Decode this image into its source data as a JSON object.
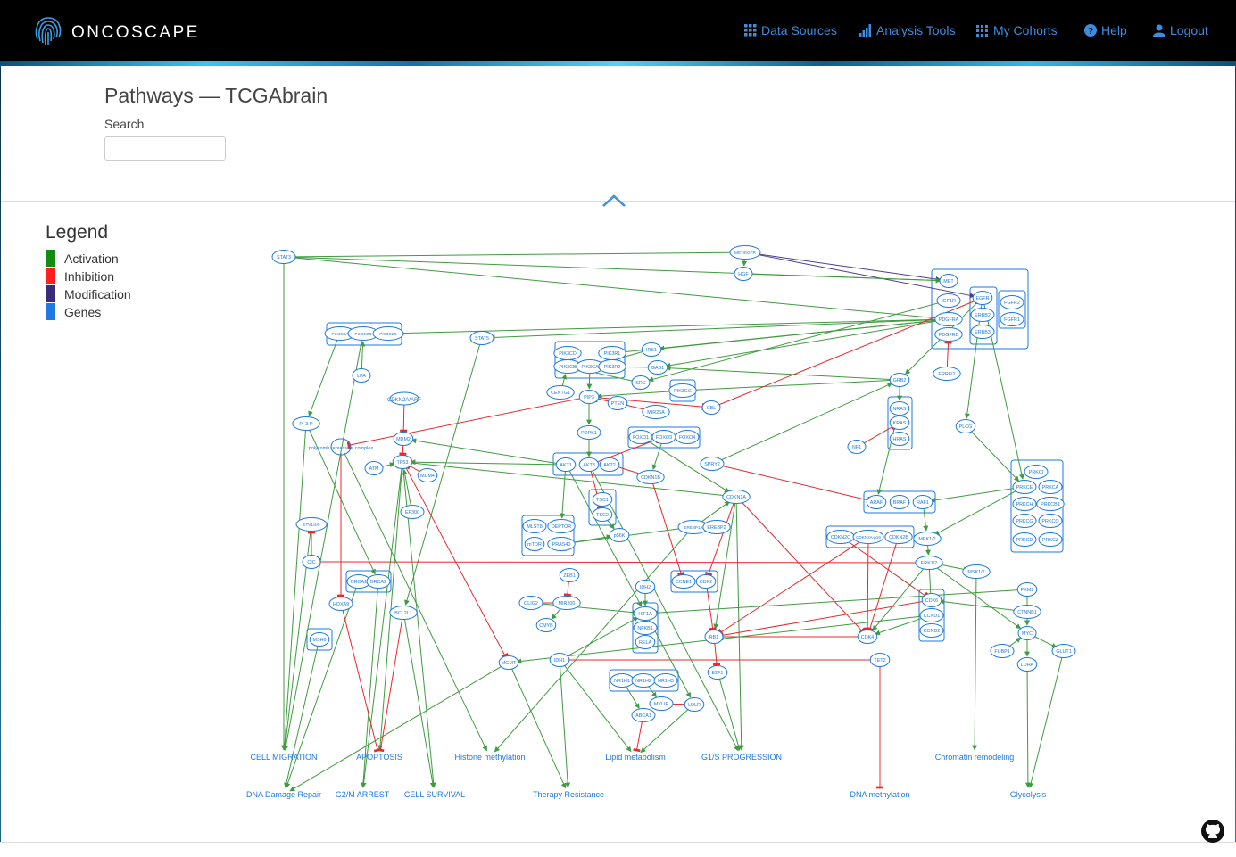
{
  "header": {
    "brand": "ONCOSCAPE",
    "nav": [
      {
        "label": "Data Sources",
        "icon": "grid-icon"
      },
      {
        "label": "Analysis Tools",
        "icon": "bar-chart-icon"
      },
      {
        "label": "My Cohorts",
        "icon": "dots-grid-icon"
      },
      {
        "label": "Help",
        "icon": "question-icon"
      },
      {
        "label": "Logout",
        "icon": "user-icon"
      }
    ]
  },
  "page": {
    "title": "Pathways — TCGAbrain",
    "search_label": "Search",
    "search_value": ""
  },
  "legend": {
    "title": "Legend",
    "items": [
      {
        "label": "Activation",
        "color": "#138c13"
      },
      {
        "label": "Inhibition",
        "color": "#ff1f1f"
      },
      {
        "label": "Modification",
        "color": "#3a2c7a"
      },
      {
        "label": "Genes",
        "color": "#1e7ae0"
      }
    ]
  },
  "colors": {
    "gene": "#1e7ae0",
    "activation": "#3f9b3f",
    "inhibition": "#e8282d",
    "modification": "#4d3c8c"
  },
  "groups": [
    {
      "id": "rtk"
    },
    {
      "id": "egfr"
    },
    {
      "id": "fgfr"
    },
    {
      "id": "pi3kc2"
    },
    {
      "id": "pi3k"
    },
    {
      "id": "pik3c2g"
    },
    {
      "id": "foxo"
    },
    {
      "id": "akt"
    },
    {
      "id": "tsc"
    },
    {
      "id": "mtor"
    },
    {
      "id": "ras"
    },
    {
      "id": "raf"
    },
    {
      "id": "prkc"
    },
    {
      "id": "cdkn2"
    },
    {
      "id": "brca"
    },
    {
      "id": "ccne"
    },
    {
      "id": "hif"
    },
    {
      "id": "cdk6"
    },
    {
      "id": "nr1h"
    },
    {
      "id": "msh6"
    }
  ],
  "nodes": [
    {
      "id": "STAT3",
      "label": "STAT3"
    },
    {
      "id": "METEGFR",
      "label": "MET/EGFR"
    },
    {
      "id": "HGF",
      "label": "HGF"
    },
    {
      "id": "MET",
      "label": "MET"
    },
    {
      "id": "IGF1R",
      "label": "IGF1R"
    },
    {
      "id": "EGFR",
      "label": "EGFR"
    },
    {
      "id": "ERBB2",
      "label": "ERBB2"
    },
    {
      "id": "ERBB3",
      "label": "ERBB3"
    },
    {
      "id": "FGFR2",
      "label": "FGFR2"
    },
    {
      "id": "FGFR1",
      "label": "FGFR1"
    },
    {
      "id": "PDGFRA",
      "label": "PDGFRA"
    },
    {
      "id": "PDGFRB",
      "label": "PDGFRB"
    },
    {
      "id": "ERRFI1",
      "label": "ERRFI1"
    },
    {
      "id": "PIK3C2A",
      "label": "PIK3C2A"
    },
    {
      "id": "PIK3C2B",
      "label": "PIK3C2B"
    },
    {
      "id": "PIK3C2G",
      "label": "PIK3C2G"
    },
    {
      "id": "STAT5",
      "label": "STAT5"
    },
    {
      "id": "LPA",
      "label": "LPA"
    },
    {
      "id": "PIK3CD",
      "label": "PIK3CD"
    },
    {
      "id": "PIK3CB",
      "label": "PIK3CB"
    },
    {
      "id": "PIK3CA",
      "label": "PIK3CA"
    },
    {
      "id": "PIK3R1",
      "label": "PIK3R1"
    },
    {
      "id": "PIK3R2",
      "label": "PIK3R2"
    },
    {
      "id": "IRS1",
      "label": "IRS1"
    },
    {
      "id": "GAB1",
      "label": "GAB1"
    },
    {
      "id": "SRC",
      "label": "SRC"
    },
    {
      "id": "CENTG1",
      "label": "CENTG1"
    },
    {
      "id": "PIP3",
      "label": "PIP3"
    },
    {
      "id": "PTEN",
      "label": "PTEN"
    },
    {
      "id": "MIR26A",
      "label": "MIR26A"
    },
    {
      "id": "PIK3CG",
      "label": "PIK3CG"
    },
    {
      "id": "CBL",
      "label": "CBL"
    },
    {
      "id": "GRB2",
      "label": "GRB2"
    },
    {
      "id": "CDKN2AARF",
      "label": "CDKN2A/ARF"
    },
    {
      "id": "PI3P",
      "label": "PI-3-P"
    },
    {
      "id": "POLY",
      "label": "polycomb repressive complex"
    },
    {
      "id": "MDM2",
      "label": "MDM2"
    },
    {
      "id": "ATM",
      "label": "ATM"
    },
    {
      "id": "TP53",
      "label": "TP53"
    },
    {
      "id": "MDM4",
      "label": "MDM4"
    },
    {
      "id": "EP300",
      "label": "EP300"
    },
    {
      "id": "PDPK1",
      "label": "PDPK1"
    },
    {
      "id": "FOXO1",
      "label": "FOXO1"
    },
    {
      "id": "FOXO3",
      "label": "FOXO3"
    },
    {
      "id": "FOXO4",
      "label": "FOXO4"
    },
    {
      "id": "AKT1",
      "label": "AKT1"
    },
    {
      "id": "AKT3",
      "label": "AKT3"
    },
    {
      "id": "AKT2",
      "label": "AKT2"
    },
    {
      "id": "CDKN1B",
      "label": "CDKN1B"
    },
    {
      "id": "SPRY2",
      "label": "SPRY2"
    },
    {
      "id": "NRAS",
      "label": "NRAS"
    },
    {
      "id": "KRAS",
      "label": "KRAS"
    },
    {
      "id": "HRAS",
      "label": "HRAS"
    },
    {
      "id": "NF1",
      "label": "NF1"
    },
    {
      "id": "PLCG",
      "label": "PLCG"
    },
    {
      "id": "PRKCI",
      "label": "PRKCI"
    },
    {
      "id": "PRKCE",
      "label": "PRKCE"
    },
    {
      "id": "PRKCA",
      "label": "PRKCA"
    },
    {
      "id": "PRKCH",
      "label": "PRKCH"
    },
    {
      "id": "PRKCB1",
      "label": "PRKCB1"
    },
    {
      "id": "PRKCG",
      "label": "PRKCG"
    },
    {
      "id": "PRKCQ",
      "label": "PRKCQ"
    },
    {
      "id": "PRKCD",
      "label": "PRKCD"
    },
    {
      "id": "PRKCZ",
      "label": "PRKCZ"
    },
    {
      "id": "TSC1",
      "label": "TSC1"
    },
    {
      "id": "TSC2",
      "label": "TSC2"
    },
    {
      "id": "CDKN1A",
      "label": "CDKN1A"
    },
    {
      "id": "ARAF",
      "label": "ARAF"
    },
    {
      "id": "BRAF",
      "label": "BRAF"
    },
    {
      "id": "RAF1",
      "label": "RAF1"
    },
    {
      "id": "MLST8",
      "label": "MLST8"
    },
    {
      "id": "DEPTOR",
      "label": "DEPTOR"
    },
    {
      "id": "mTOR",
      "label": "mTOR"
    },
    {
      "id": "PRAS40",
      "label": "PRAS40"
    },
    {
      "id": "P56K",
      "label": "p56K"
    },
    {
      "id": "EREBP1A",
      "label": "EREBP1A"
    },
    {
      "id": "EREBP2",
      "label": "EREBP2"
    },
    {
      "id": "CDKN2C",
      "label": "CDKN2C"
    },
    {
      "id": "CDKN2A",
      "label": "CDKN2A-p16"
    },
    {
      "id": "CDKN2B",
      "label": "CDKN2B"
    },
    {
      "id": "MEK12",
      "label": "MEK1/2"
    },
    {
      "id": "ETV145",
      "label": "ETV1/4/5"
    },
    {
      "id": "CIC",
      "label": "CIC"
    },
    {
      "id": "ERK12",
      "label": "ERK1/2"
    },
    {
      "id": "MSK12",
      "label": "MSK1/2"
    },
    {
      "id": "ZEB1",
      "label": "ZEB1"
    },
    {
      "id": "BRCA1",
      "label": "BRCA1"
    },
    {
      "id": "BRCA2",
      "label": "BRCA2"
    },
    {
      "id": "IDH2",
      "label": "IDH2"
    },
    {
      "id": "CCNE1",
      "label": "CCNE1"
    },
    {
      "id": "CDK2",
      "label": "CDK2"
    },
    {
      "id": "HOXA9",
      "label": "HOXA9"
    },
    {
      "id": "OLIG2",
      "label": "OLIG2"
    },
    {
      "id": "MIR200",
      "label": "MIR200"
    },
    {
      "id": "HIF1A",
      "label": "HIF1A"
    },
    {
      "id": "CDK6",
      "label": "CDK6"
    },
    {
      "id": "PKM2",
      "label": "PKM2"
    },
    {
      "id": "BCL2L1",
      "label": "BCL2L1"
    },
    {
      "id": "CMYB",
      "label": "CMYB"
    },
    {
      "id": "NFKB1",
      "label": "NFKB1"
    },
    {
      "id": "CCND1",
      "label": "CCND1"
    },
    {
      "id": "CTNNB1",
      "label": "CTNNB1"
    },
    {
      "id": "MSH6",
      "label": "MSH6"
    },
    {
      "id": "RB1",
      "label": "RB1"
    },
    {
      "id": "RELA",
      "label": "RELA"
    },
    {
      "id": "CCND2",
      "label": "CCND2"
    },
    {
      "id": "CDK4",
      "label": "CDK4"
    },
    {
      "id": "MYC",
      "label": "MYC"
    },
    {
      "id": "FUBP1",
      "label": "FUBP1"
    },
    {
      "id": "GLUT1",
      "label": "GLUT1"
    },
    {
      "id": "MGMT",
      "label": "MGMT"
    },
    {
      "id": "IDH1",
      "label": "IDH1"
    },
    {
      "id": "TET2",
      "label": "TET2"
    },
    {
      "id": "LDHA",
      "label": "LDHA"
    },
    {
      "id": "E2F1",
      "label": "E2F1"
    },
    {
      "id": "NR1H1",
      "label": "NR1H1"
    },
    {
      "id": "NR1H2",
      "label": "NR1H2"
    },
    {
      "id": "NR1H3",
      "label": "NR1H3"
    },
    {
      "id": "MYLIP",
      "label": "MYLIP"
    },
    {
      "id": "LDLR",
      "label": "LDLR"
    },
    {
      "id": "ABCA1",
      "label": "ABCA1"
    }
  ],
  "processes": [
    {
      "id": "CELLMIG",
      "label": "CELL MIGRATION"
    },
    {
      "id": "APOPT",
      "label": "APOPTOSIS"
    },
    {
      "id": "HISTONE",
      "label": "Histone methylation"
    },
    {
      "id": "LIPID",
      "label": "Lipid metabolism"
    },
    {
      "id": "G1S",
      "label": "G1/S PROGRESSION"
    },
    {
      "id": "CHROM",
      "label": "Chromatin remodeling"
    },
    {
      "id": "DNADR",
      "label": "DNA Damage Repair"
    },
    {
      "id": "G2M",
      "label": "G2/M ARREST"
    },
    {
      "id": "CELLSURV",
      "label": "CELL SURVIVAL"
    },
    {
      "id": "THERAPY",
      "label": "Therapy Resistance"
    },
    {
      "id": "DNAMETH",
      "label": "DNA methylation"
    },
    {
      "id": "GLYCO",
      "label": "Glycolysis"
    }
  ],
  "edges": [
    [
      "STAT3",
      "METEGFR",
      "a"
    ],
    [
      "STAT3",
      "MET",
      "a"
    ],
    [
      "STAT3",
      "PDGFRA",
      "a"
    ],
    [
      "STAT3",
      "CELLMIG",
      "a"
    ],
    [
      "METEGFR",
      "MET",
      "m"
    ],
    [
      "METEGFR",
      "EGFR",
      "m"
    ],
    [
      "HGF",
      "MET",
      "a"
    ],
    [
      "METEGFR",
      "HGF",
      "a"
    ],
    [
      "PDGFRA",
      "PIK3C2G",
      "a"
    ],
    [
      "PDGFRA",
      "STAT5",
      "a"
    ],
    [
      "PDGFRA",
      "IRS1",
      "a"
    ],
    [
      "PDGFRA",
      "GAB1",
      "a"
    ],
    [
      "PDGFRA",
      "PIK3R1",
      "a"
    ],
    [
      "IGF1R",
      "SRC",
      "a"
    ],
    [
      "EGFR",
      "GRB2",
      "a"
    ],
    [
      "ERRFI1",
      "PDGFRB",
      "i"
    ],
    [
      "EGFR",
      "PLCG",
      "a"
    ],
    [
      "EGFR",
      "PRKCE",
      "a"
    ],
    [
      "PIK3C2A",
      "PI3P",
      "a"
    ],
    [
      "LPA",
      "PIK3C2B",
      "a"
    ],
    [
      "PI3P",
      "CELLMIG",
      "a"
    ],
    [
      "STAT5",
      "BCL2L1",
      "a"
    ],
    [
      "GRB2",
      "GAB1",
      "a"
    ],
    [
      "GRB2",
      "PIK3CG",
      "a"
    ],
    [
      "GRB2",
      "NRAS",
      "a"
    ],
    [
      "NF1",
      "KRAS",
      "i"
    ],
    [
      "CBL",
      "EGFR",
      "i"
    ],
    [
      "SRC",
      "PIK3CB",
      "a"
    ],
    [
      "IRS1",
      "PIK3CA",
      "a"
    ],
    [
      "GAB1",
      "PIK3CA",
      "a"
    ],
    [
      "CENTG1",
      "PIK3CB",
      "a"
    ],
    [
      "PIK3CG",
      "PIP3",
      "a"
    ],
    [
      "PIK3CA",
      "PIP3",
      "a"
    ],
    [
      "PTEN",
      "PIP3",
      "i"
    ],
    [
      "MIR26A",
      "PTEN",
      "i"
    ],
    [
      "PIP3",
      "PDPK1",
      "a"
    ],
    [
      "PDPK1",
      "AKT3",
      "a"
    ],
    [
      "PIP3",
      "POLY",
      "i"
    ],
    [
      "CDKN2AARF",
      "MDM2",
      "i"
    ],
    [
      "MDM2",
      "TP53",
      "i"
    ],
    [
      "MDM4",
      "TP53",
      "i"
    ],
    [
      "ATM",
      "TP53",
      "a"
    ],
    [
      "EP300",
      "TP53",
      "a"
    ],
    [
      "TP53",
      "CDKN1A",
      "a"
    ],
    [
      "TP53",
      "APOPT",
      "a"
    ],
    [
      "TP53",
      "MGMT",
      "i"
    ],
    [
      "TP53",
      "G2M",
      "a"
    ],
    [
      "AKT1",
      "MDM2",
      "a"
    ],
    [
      "AKT1",
      "TP53",
      "a"
    ],
    [
      "AKT2",
      "CDKN1B",
      "i"
    ],
    [
      "AKT3",
      "FOXO3",
      "i"
    ],
    [
      "AKT3",
      "TSC2",
      "i"
    ],
    [
      "AKT1",
      "DEPTOR",
      "a"
    ],
    [
      "AKT1",
      "HIF1A",
      "a"
    ],
    [
      "FOXO3",
      "CDKN1B",
      "a"
    ],
    [
      "FOXO1",
      "CDKN1A",
      "a"
    ],
    [
      "SPRY2",
      "ARAF",
      "i"
    ],
    [
      "SPRY2",
      "GRB2",
      "a"
    ],
    [
      "PIP3",
      "CBL",
      "i"
    ],
    [
      "CDKN1B",
      "CCNE1",
      "i"
    ],
    [
      "CDKN1A",
      "CDK4",
      "i"
    ],
    [
      "CDKN1A",
      "CDK2",
      "i"
    ],
    [
      "CDKN1A",
      "G1S",
      "a"
    ],
    [
      "CDKN1A",
      "RB1",
      "a"
    ],
    [
      "NRAS",
      "ARAF",
      "a"
    ],
    [
      "RAF1",
      "MEK12",
      "a"
    ],
    [
      "MEK12",
      "ERK12",
      "a"
    ],
    [
      "PRKCE",
      "RAF1",
      "a"
    ],
    [
      "PRKCE",
      "MEK12",
      "a"
    ],
    [
      "PLCG",
      "PRKCE",
      "a"
    ],
    [
      "ERK12",
      "CIC",
      "i"
    ],
    [
      "ERK12",
      "MSK12",
      "a"
    ],
    [
      "ERK12",
      "MYC",
      "a"
    ],
    [
      "ERK12",
      "CDK4",
      "a"
    ],
    [
      "ERK12",
      "CCND1",
      "a"
    ],
    [
      "MSK12",
      "CHROM",
      "a"
    ],
    [
      "ETV145",
      "CELLMIG",
      "a"
    ],
    [
      "CIC",
      "ETV145",
      "i"
    ],
    [
      "TSC2",
      "P56K",
      "a"
    ],
    [
      "EREBP1A",
      "PRAS40",
      "a"
    ],
    [
      "EREBP1A",
      "CDKN1A",
      "a"
    ],
    [
      "PRAS40",
      "P56K",
      "a"
    ],
    [
      "EREBP1A",
      "HISTONE",
      "a"
    ],
    [
      "CDKN2A",
      "CDK4",
      "i"
    ],
    [
      "CDKN2A",
      "RB1",
      "i"
    ],
    [
      "CDKN2B",
      "CDK4",
      "i"
    ],
    [
      "CDKN2C",
      "CDK6",
      "i"
    ],
    [
      "CDK4",
      "RB1",
      "i"
    ],
    [
      "CDK6",
      "RB1",
      "i"
    ],
    [
      "CDK2",
      "RB1",
      "i"
    ],
    [
      "RB1",
      "E2F1",
      "i"
    ],
    [
      "E2F1",
      "G1S",
      "a"
    ],
    [
      "CCND1",
      "CDK4",
      "a"
    ],
    [
      "ZEB1",
      "MIR200",
      "i"
    ],
    [
      "MIR200",
      "OLIG2",
      "i"
    ],
    [
      "MIR200",
      "CMYB",
      "a"
    ],
    [
      "OLIG2",
      "HIF1A",
      "a"
    ],
    [
      "IDH2",
      "HIF1A",
      "a"
    ],
    [
      "IDH1",
      "HIF1A",
      "a"
    ],
    [
      "IDH1",
      "TET2",
      "i"
    ],
    [
      "IDH1",
      "LIPID",
      "a"
    ],
    [
      "IDH1",
      "THERAPY",
      "a"
    ],
    [
      "HIF1A",
      "LDLR",
      "a"
    ],
    [
      "TET2",
      "DNAMETH",
      "i"
    ],
    [
      "MGMT",
      "DNADR",
      "a"
    ],
    [
      "MGMT",
      "THERAPY",
      "a"
    ],
    [
      "BRCA1",
      "DNADR",
      "a"
    ],
    [
      "BRCA2",
      "G2M",
      "a"
    ],
    [
      "HOXA9",
      "APOPT",
      "i"
    ],
    [
      "POLY",
      "HOXA9",
      "i"
    ],
    [
      "MSH6",
      "DNADR",
      "a"
    ],
    [
      "BCL2L1",
      "CELLSURV",
      "a"
    ],
    [
      "BCL2L1",
      "APOPT",
      "i"
    ],
    [
      "POLY",
      "HISTONE",
      "a"
    ],
    [
      "PI3P",
      "BRCA2",
      "a"
    ],
    [
      "PKM2",
      "MYC",
      "a"
    ],
    [
      "PKM2",
      "HIF1A",
      "a"
    ],
    [
      "CTNNB1",
      "MYC",
      "a"
    ],
    [
      "MYC",
      "LDHA",
      "a"
    ],
    [
      "MYC",
      "GLUT1",
      "a"
    ],
    [
      "FUBP1",
      "MYC",
      "a"
    ],
    [
      "LDHA",
      "GLYCO",
      "a"
    ],
    [
      "GLUT1",
      "GLYCO",
      "a"
    ],
    [
      "CTNNB1",
      "CDK6",
      "a"
    ],
    [
      "CCND1",
      "MGMT",
      "a"
    ],
    [
      "NR1H1",
      "ABCA1",
      "a"
    ],
    [
      "NR1H2",
      "MYLIP",
      "a"
    ],
    [
      "MYLIP",
      "LDLR",
      "i"
    ],
    [
      "ABCA1",
      "LIPID",
      "i"
    ],
    [
      "LDLR",
      "LIPID",
      "a"
    ],
    [
      "AKT3",
      "G1S",
      "a"
    ],
    [
      "PIK3C2B",
      "CELLMIG",
      "a"
    ],
    [
      "TP53",
      "CELLSURV",
      "a"
    ]
  ]
}
